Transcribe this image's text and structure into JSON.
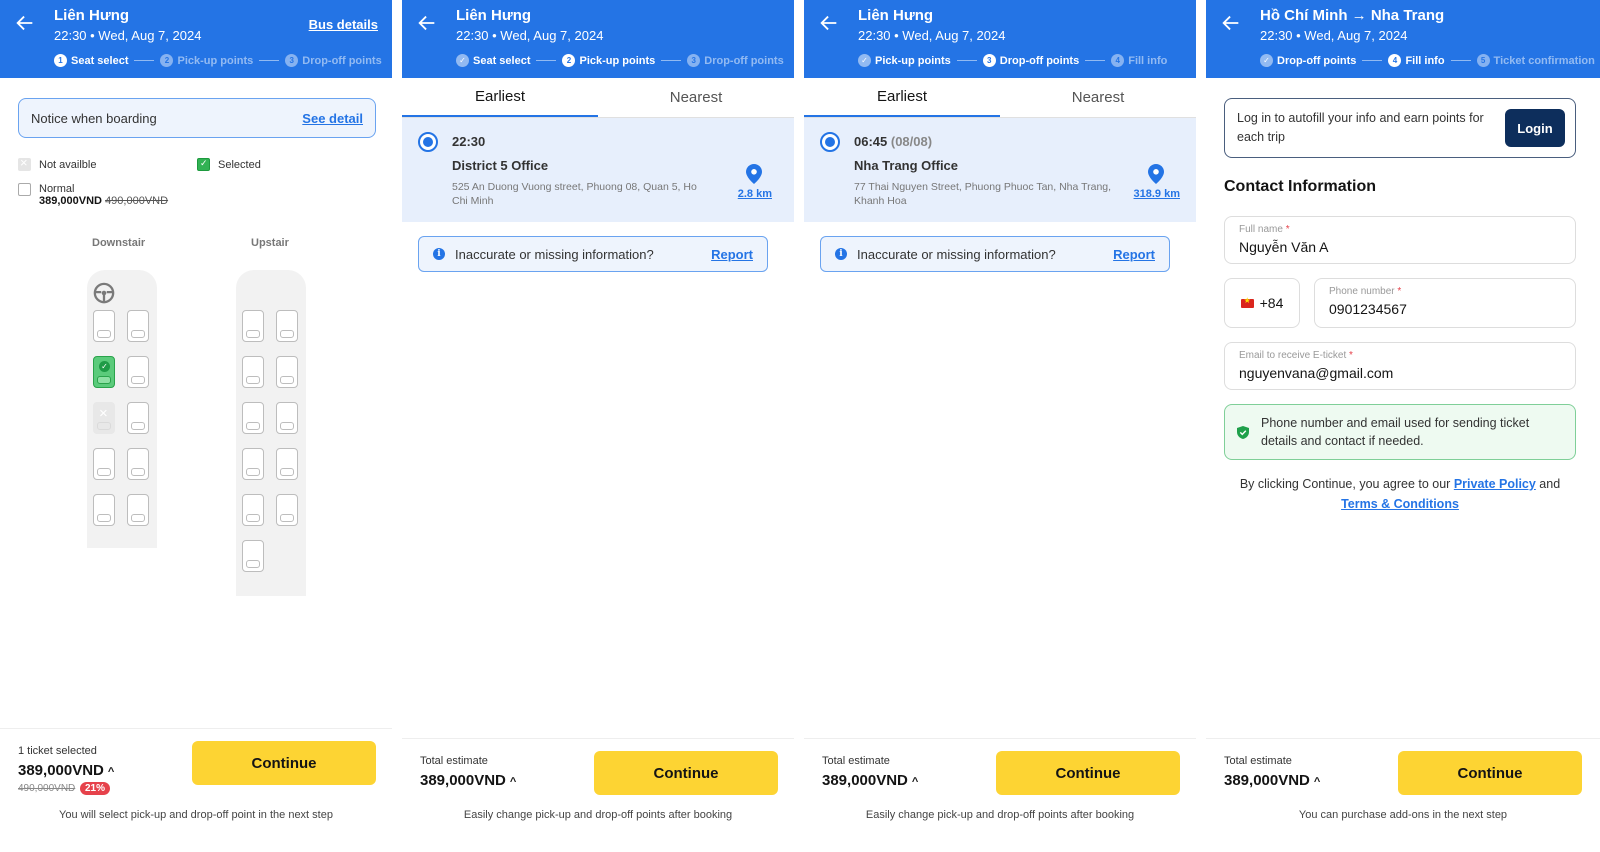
{
  "colors": {
    "brand_blue": "#2474e5",
    "continue_yellow": "#fdd433",
    "selected_green": "#32b254",
    "login_navy": "#0d2e5c",
    "discount_red": "#e6424b"
  },
  "screens": [
    {
      "header": {
        "title": "Liên Hưng",
        "subtitle": "22:30 • Wed, Aug 7, 2024",
        "link": "Bus details"
      },
      "steps": [
        {
          "num": "1",
          "label": "Seat select",
          "state": "active"
        },
        {
          "num": "2",
          "label": "Pick-up points",
          "state": "inactive"
        },
        {
          "num": "3",
          "label": "Drop-off points",
          "state": "inactive"
        }
      ],
      "notice": {
        "text": "Notice when boarding",
        "link": "See detail"
      },
      "legend": {
        "not_available": "Not availble",
        "selected": "Selected",
        "normal": "Normal",
        "normal_price": "389,000VND",
        "normal_old_price": "490,000VND"
      },
      "decks": [
        {
          "label": "Downstair",
          "rows": [
            [
              "available",
              "available"
            ],
            [
              "selected",
              "available"
            ],
            [
              "unavailable",
              "available"
            ],
            [
              "available",
              "available"
            ],
            [
              "available",
              "available"
            ]
          ]
        },
        {
          "label": "Upstair",
          "rows": [
            [
              "available",
              "available"
            ],
            [
              "available",
              "available"
            ],
            [
              "available",
              "available"
            ],
            [
              "available",
              "available"
            ],
            [
              "available",
              "available"
            ],
            [
              "available"
            ]
          ]
        }
      ],
      "bottom": {
        "label": "1 ticket selected",
        "price": "389,000VND",
        "old_price": "490,000VND",
        "discount": "21%",
        "button": "Continue",
        "note": "You will select pick-up and drop-off point in the next step"
      }
    },
    {
      "header": {
        "title": "Liên Hưng",
        "subtitle": "22:30 • Wed, Aug 7, 2024"
      },
      "steps": [
        {
          "num": "✓",
          "label": "Seat select",
          "state": "done"
        },
        {
          "num": "2",
          "label": "Pick-up points",
          "state": "active"
        },
        {
          "num": "3",
          "label": "Drop-off points",
          "state": "inactive"
        }
      ],
      "tabs": [
        "Earliest",
        "Nearest"
      ],
      "point": {
        "time": "22:30",
        "date": "",
        "name": "District 5 Office",
        "address": "525 An Duong Vuong street, Phuong 08, Quan 5, Ho Chi Minh",
        "distance": "2.8 km"
      },
      "report": {
        "text": "Inaccurate or missing information?",
        "link": "Report"
      },
      "bottom": {
        "label": "Total estimate",
        "price": "389,000VND",
        "button": "Continue",
        "note": "Easily change pick-up and drop-off points after booking"
      }
    },
    {
      "header": {
        "title": "Liên Hưng",
        "subtitle": "22:30 • Wed, Aug 7, 2024"
      },
      "steps": [
        {
          "num": "✓",
          "label": "Pick-up points",
          "state": "done"
        },
        {
          "num": "3",
          "label": "Drop-off points",
          "state": "active"
        },
        {
          "num": "4",
          "label": "Fill info",
          "state": "inactive"
        }
      ],
      "tabs": [
        "Earliest",
        "Nearest"
      ],
      "point": {
        "time": "06:45",
        "date": "(08/08)",
        "name": "Nha Trang Office",
        "address": "77 Thai Nguyen Street, Phuong Phuoc Tan, Nha Trang, Khanh Hoa",
        "distance": "318.9 km"
      },
      "report": {
        "text": "Inaccurate or missing information?",
        "link": "Report"
      },
      "bottom": {
        "label": "Total estimate",
        "price": "389,000VND",
        "button": "Continue",
        "note": "Easily change pick-up and drop-off points after booking"
      }
    },
    {
      "header": {
        "title": "Hồ Chí Minh → Nha Trang",
        "subtitle": "22:30 • Wed, Aug 7, 2024"
      },
      "steps": [
        {
          "num": "✓",
          "label": "Drop-off points",
          "state": "done"
        },
        {
          "num": "4",
          "label": "Fill info",
          "state": "active"
        },
        {
          "num": "5",
          "label": "Ticket confirmation",
          "state": "inactive"
        }
      ],
      "login": {
        "text": "Log in to autofill your info and earn points for each trip",
        "button": "Login"
      },
      "section_title": "Contact Information",
      "fields": {
        "full_name": {
          "label": "Full name",
          "value": "Nguyễn Văn A"
        },
        "country_code": "+84",
        "phone": {
          "label": "Phone number",
          "value": "0901234567"
        },
        "email": {
          "label": "Email to receive E-ticket",
          "value": "nguyenvana@gmail.com"
        },
        "required_mark": "*"
      },
      "info_box": "Phone number and email used for sending ticket details and contact if needed.",
      "agree": {
        "prefix": "By clicking Continue, you agree to our ",
        "policy_link": "Private Policy",
        "conj": " and",
        "terms_link": "Terms & Conditions"
      },
      "bottom": {
        "label": "Total estimate",
        "price": "389,000VND",
        "button": "Continue",
        "note": "You can purchase add-ons in the next step"
      }
    }
  ]
}
